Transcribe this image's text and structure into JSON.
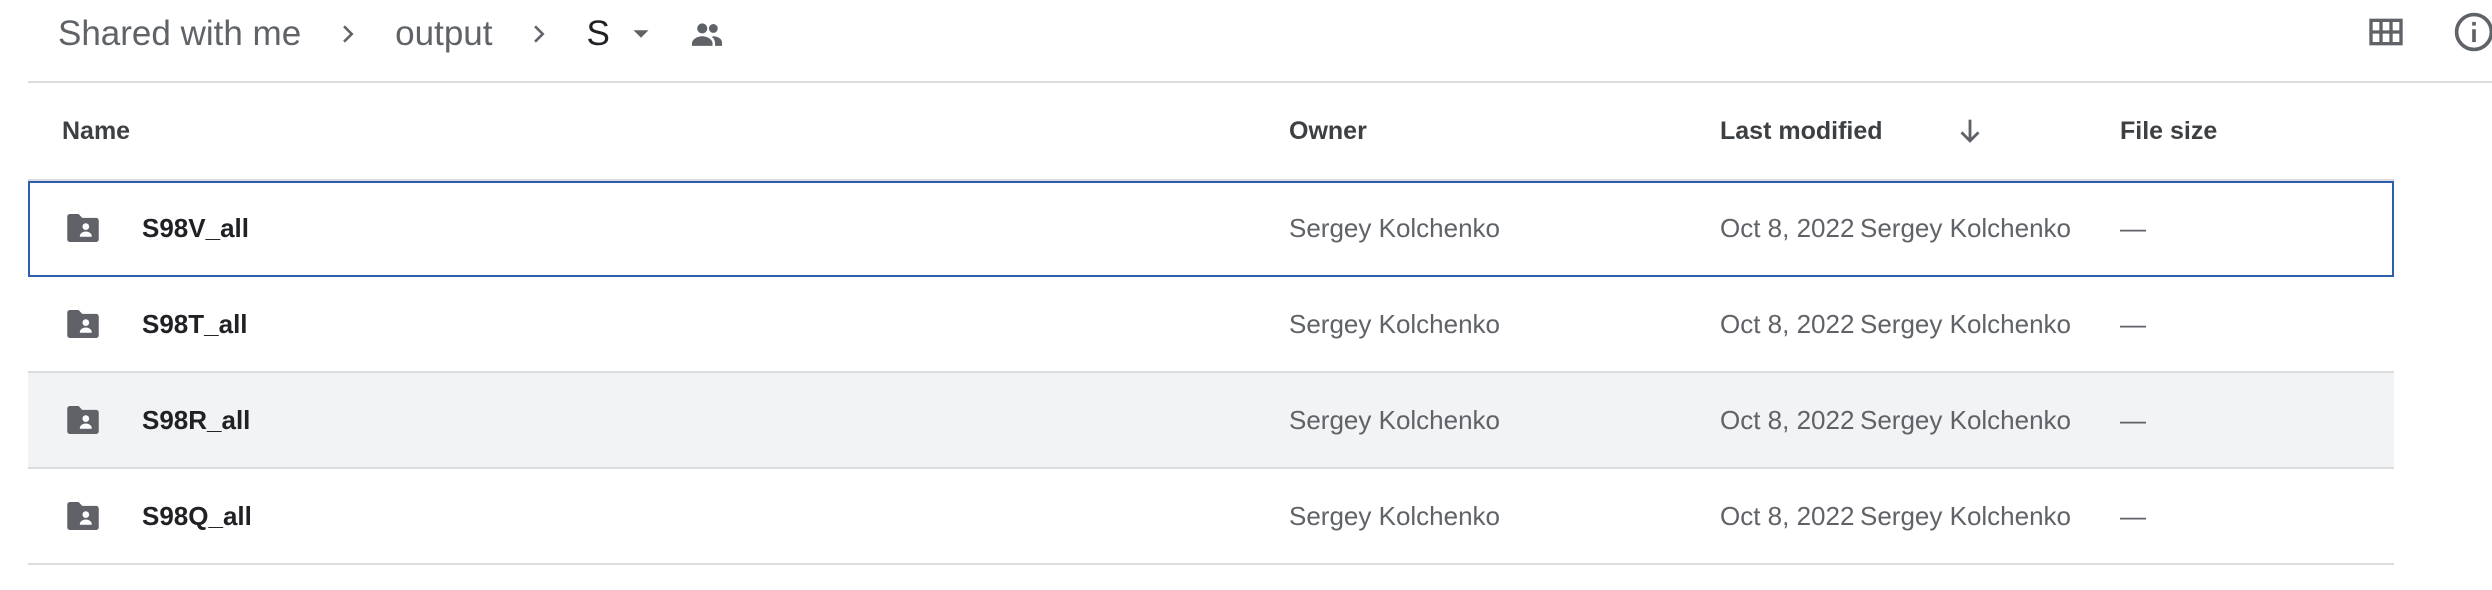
{
  "breadcrumb": {
    "items": [
      "Shared with me",
      "output",
      "S"
    ]
  },
  "header": {
    "icons": {
      "separator": "chevron-right-icon",
      "caret": "caret-down-icon",
      "shared": "people-icon",
      "grid_view": "grid-view-icon",
      "info": "info-icon"
    }
  },
  "table": {
    "columns": {
      "name": "Name",
      "owner": "Owner",
      "last_modified": "Last modified",
      "file_size": "File size"
    },
    "sort": {
      "column": "last_modified",
      "direction": "descending",
      "icon": "arrow-down-icon"
    },
    "rows": [
      {
        "name": "S98V_all",
        "owner": "Sergey Kolchenko",
        "date": "Oct 8, 2022",
        "modified_by": "Sergey Kolchenko",
        "size": "—",
        "icon": "shared-folder-icon",
        "state": "selected"
      },
      {
        "name": "S98T_all",
        "owner": "Sergey Kolchenko",
        "date": "Oct 8, 2022",
        "modified_by": "Sergey Kolchenko",
        "size": "—",
        "icon": "shared-folder-icon",
        "state": "normal"
      },
      {
        "name": "S98R_all",
        "owner": "Sergey Kolchenko",
        "date": "Oct 8, 2022",
        "modified_by": "Sergey Kolchenko",
        "size": "—",
        "icon": "shared-folder-icon",
        "state": "hover"
      },
      {
        "name": "S98Q_all",
        "owner": "Sergey Kolchenko",
        "date": "Oct 8, 2022",
        "modified_by": "Sergey Kolchenko",
        "size": "—",
        "icon": "shared-folder-icon",
        "state": "normal"
      }
    ]
  },
  "colors": {
    "selection_border": "#2f5eab",
    "hover_background": "#f1f3f4",
    "divider": "#dadce0",
    "icon": "#5f6368"
  }
}
